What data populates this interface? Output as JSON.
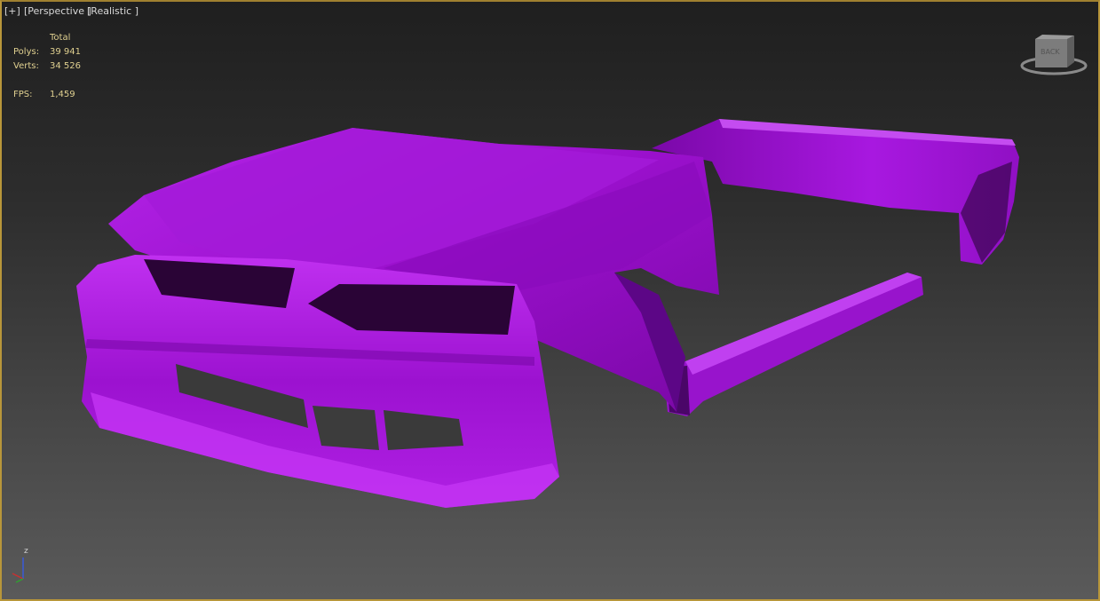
{
  "viewport": {
    "menu_plus": "[+]",
    "view_label": "[Perspective ]",
    "shading_label": "[Realistic ]",
    "stats": {
      "header": "Total",
      "polys_label": "Polys:",
      "polys_value": "39 941",
      "verts_label": "Verts:",
      "verts_value": "34 526",
      "fps_label": "FPS:",
      "fps_value": "1,459"
    },
    "viewcube_face": "BACK",
    "axis_label": "z",
    "model_color": "#a012d8",
    "border_color": "#b8963a"
  }
}
